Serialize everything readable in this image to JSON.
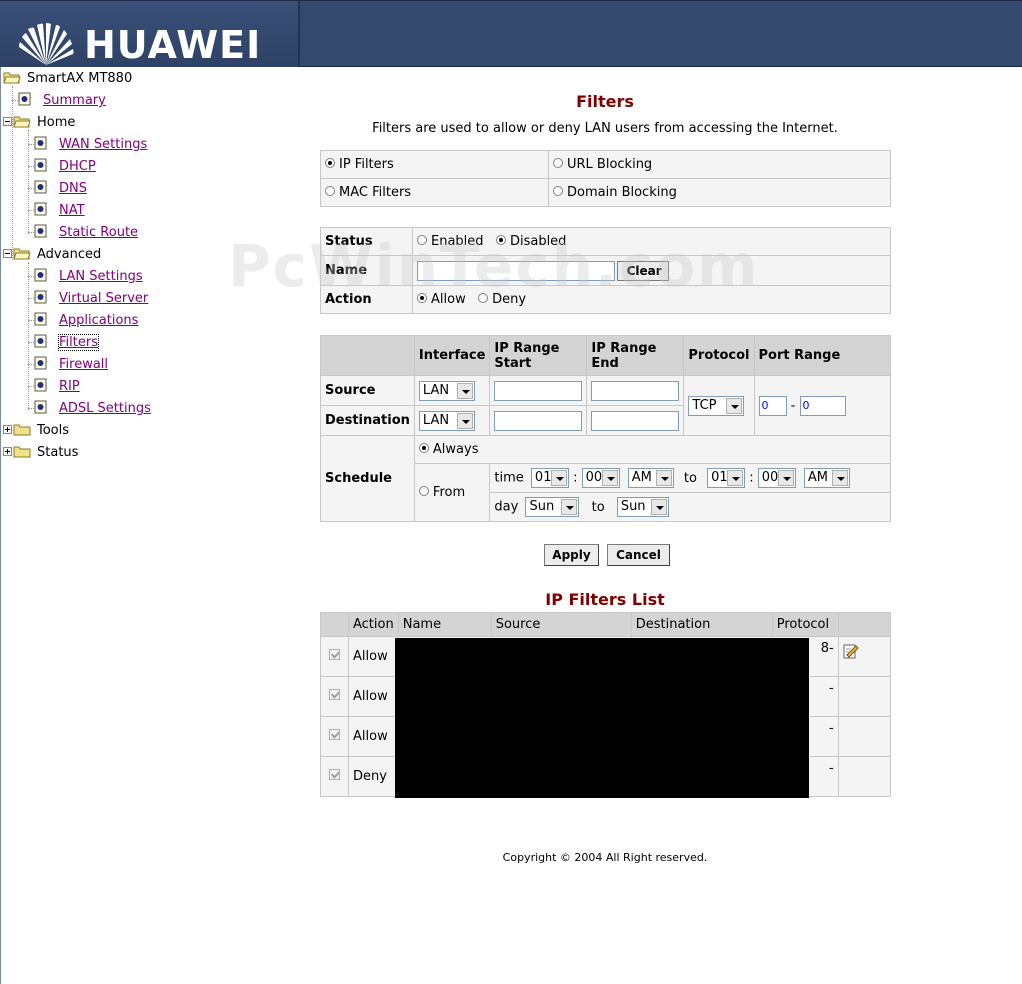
{
  "brand": {
    "name": "HUAWEI"
  },
  "tree": {
    "root": "SmartAX MT880",
    "summary": "Summary",
    "home": "Home",
    "home_items": [
      "WAN Settings",
      "DHCP",
      "DNS",
      "NAT",
      "Static Route"
    ],
    "advanced": "Advanced",
    "advanced_items": [
      "LAN Settings",
      "Virtual Server",
      "Applications",
      "Filters",
      "Firewall",
      "RIP",
      "ADSL Settings"
    ],
    "tools": "Tools",
    "status": "Status"
  },
  "page": {
    "title": "Filters",
    "description": "Filters are used to allow or deny LAN users from accessing the Internet.",
    "filter_types": [
      "IP Filters",
      "URL Blocking",
      "MAC Filters",
      "Domain Blocking"
    ],
    "selected_filter": "IP Filters"
  },
  "rule": {
    "status_label": "Status",
    "enabled": "Enabled",
    "disabled": "Disabled",
    "name_label": "Name",
    "clear": "Clear",
    "action_label": "Action",
    "allow": "Allow",
    "deny": "Deny"
  },
  "ranges": {
    "headers": [
      "Interface",
      "IP Range Start",
      "IP Range End",
      "Protocol",
      "Port Range"
    ],
    "source_label": "Source",
    "destination_label": "Destination",
    "source_if": "LAN",
    "destination_if": "LAN",
    "protocol": "TCP",
    "port_from": "0",
    "port_sep": "-",
    "port_to": "0"
  },
  "schedule": {
    "label": "Schedule",
    "always": "Always",
    "from": "From",
    "time_label": "time",
    "t1_hour": "01",
    "t1_min": "00",
    "t1_ampm": "AM",
    "to": "to",
    "colon": ":",
    "t2_hour": "01",
    "t2_min": "00",
    "t2_ampm": "AM",
    "day_label": "day",
    "day_from": "Sun",
    "day_to": "Sun"
  },
  "buttons": {
    "apply": "Apply",
    "cancel": "Cancel"
  },
  "list": {
    "title": "IP Filters List",
    "headers": [
      "Action",
      "Name",
      "Source",
      "Destination",
      "Protocol"
    ],
    "rows": [
      {
        "action": "Allow",
        "trail": "8-"
      },
      {
        "action": "Allow",
        "trail": "-"
      },
      {
        "action": "Allow",
        "trail": "-"
      },
      {
        "action": "Deny",
        "trail": "-"
      }
    ]
  },
  "footer": {
    "copyright": "Copyright © 2004 All Right reserved."
  },
  "watermark": "PcWinTech.com",
  "colors": {
    "header_bg": "#34496e",
    "title": "#800000",
    "link": "#800080"
  }
}
